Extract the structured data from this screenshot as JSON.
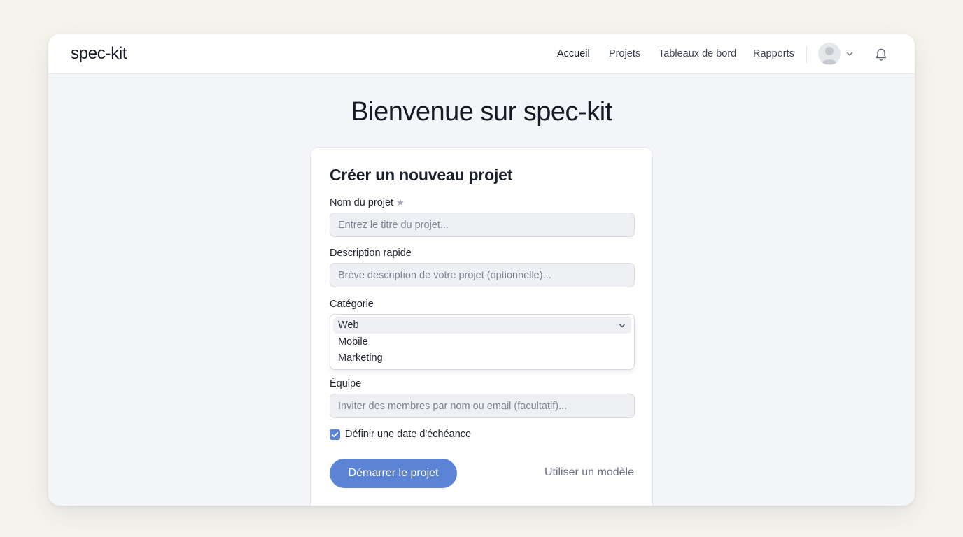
{
  "app": {
    "brand": "spec-kit"
  },
  "nav": {
    "items": [
      {
        "label": "Accueil"
      },
      {
        "label": "Projets"
      },
      {
        "label": "Tableaux de bord"
      },
      {
        "label": "Rapports"
      }
    ],
    "icons": {
      "avatar": "user-avatar",
      "menu": "chevron-down-icon",
      "notifications": "bell-icon"
    }
  },
  "page": {
    "headline": "Bienvenue sur spec-kit"
  },
  "form": {
    "title": "Créer un nouveau projet",
    "name": {
      "label": "Nom du projet",
      "required_mark": "★",
      "placeholder": "Entrez le titre du projet...",
      "value": ""
    },
    "description": {
      "label": "Description rapide",
      "placeholder": "Brève description de votre projet (optionnelle)...",
      "value": ""
    },
    "category": {
      "label": "Catégorie",
      "selected": "Web",
      "options": [
        "Web",
        "Mobile",
        "Marketing"
      ]
    },
    "team": {
      "label": "Équipe",
      "placeholder": "Inviter des membres par nom ou email (facultatif)...",
      "value": ""
    },
    "due_date": {
      "label": "Définir une date d'échéance",
      "checked": true
    },
    "submit_label": "Démarrer le projet",
    "template_label": "Utiliser un modèle"
  },
  "colors": {
    "accent": "#5b84d6",
    "background": "#f7f4ee",
    "panel": "#f3f5f8",
    "input_bg": "#eef0f3",
    "text": "#1f2430",
    "muted": "#6b7280"
  }
}
